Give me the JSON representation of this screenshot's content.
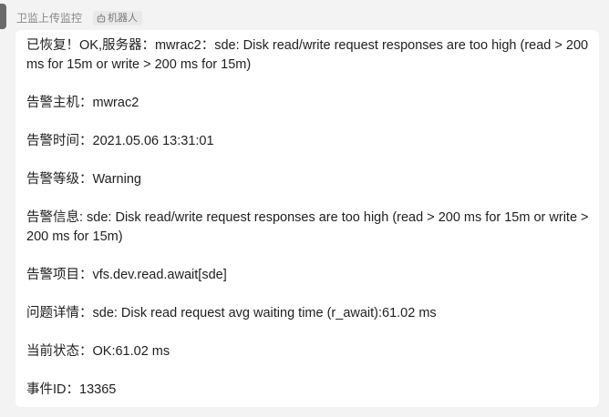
{
  "header": {
    "sender_name": "卫监上传监控",
    "bot_badge_label": "机器人",
    "bot_icon": "robot-icon"
  },
  "message": {
    "lines": [
      "已恢复！OK,服务器：mwrac2：sde: Disk read/write request responses are too high (read > 200 ms for 15m or write > 200 ms for 15m)",
      "告警主机：mwrac2",
      "告警时间：2021.05.06 13:31:01",
      "告警等级：Warning",
      "告警信息: sde: Disk read/write request responses are too high (read > 200 ms for 15m or write > 200 ms for 15m)",
      "告警项目：vfs.dev.read.await[sde]",
      "问题详情：sde: Disk read request avg waiting time (r_await):61.02 ms",
      "当前状态：OK:61.02 ms",
      "事件ID：13365"
    ]
  },
  "colors": {
    "background": "#f3f3f3",
    "bubble": "#ffffff",
    "text": "#1f1f1f",
    "meta_text": "#888888"
  }
}
